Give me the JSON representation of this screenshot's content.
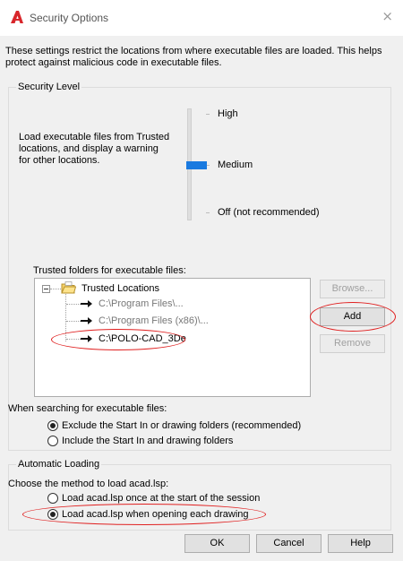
{
  "window": {
    "title": "Security Options",
    "close_glyph": "×"
  },
  "intro_text": "These settings restrict the locations from where executable files are loaded.  This helps protect against malicious code in executable files.",
  "security_level": {
    "legend": "Security Level",
    "description": "Load executable files from Trusted locations, and display a warning for other locations.",
    "levels": [
      "High",
      "Medium",
      "Off (not recommended)"
    ],
    "selected": "Medium"
  },
  "trusted_folders": {
    "label": "Trusted folders for executable files:",
    "root": "Trusted Locations",
    "items": [
      "C:\\Program Files\\...",
      "C:\\Program Files (x86)\\...",
      "C:\\POLO-CAD_3De"
    ],
    "buttons": {
      "browse": "Browse...",
      "add": "Add",
      "remove": "Remove"
    }
  },
  "search": {
    "label": "When searching for executable files:",
    "options": [
      "Exclude the Start In or drawing folders (recommended)",
      "Include the Start In and drawing folders"
    ],
    "selected_index": 0
  },
  "automatic_loading": {
    "legend": "Automatic Loading",
    "label": "Choose the method to load acad.lsp:",
    "options": [
      "Load acad.lsp once at the start of the session",
      "Load acad.lsp when opening each drawing"
    ],
    "selected_index": 1
  },
  "footer": {
    "ok": "OK",
    "cancel": "Cancel",
    "help": "Help"
  },
  "colors": {
    "accent": "#1a7ae0",
    "callout": "#e02020",
    "autocad_red": "#d8262b"
  }
}
